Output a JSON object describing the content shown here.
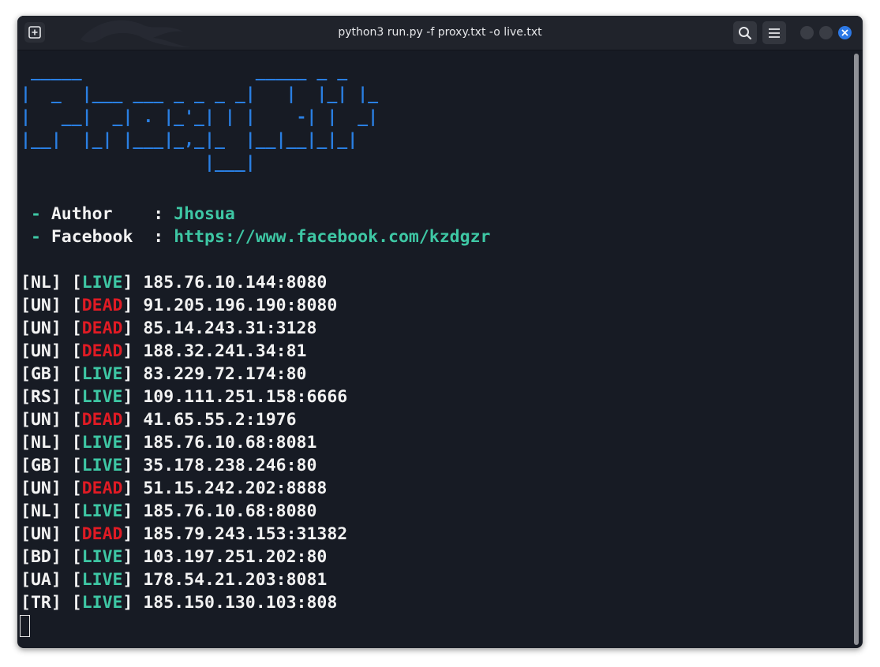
{
  "window": {
    "title": "python3 run.py -f proxy.txt -o live.txt"
  },
  "icons": {
    "new_tab": "plus-square-icon",
    "search": "search-icon",
    "menu": "hamburger-menu-icon",
    "minimize": "minimize-icon",
    "maximize": "maximize-icon",
    "close": "close-icon"
  },
  "colors": {
    "banner": "#2a7fe2",
    "accent": "#3ec7a4",
    "dead": "#e01b24",
    "background": "#171b24"
  },
  "terminal": {
    "banner": [
      " _____                 _____ _ _",
      "|  _  |___ ___ _ _ _ _|   |  |_| |_",
      "|   __|  _| . |_'_| | |    -| |  _|",
      "|__|  |_| |___|_,_|_  |__|__|_|_|",
      "                  |___|"
    ],
    "info": [
      {
        "prefix": " - ",
        "label": "Author    ",
        "sep": ": ",
        "value": "Jhosua"
      },
      {
        "prefix": " - ",
        "label": "Facebook  ",
        "sep": ": ",
        "value": "https://www.facebook.com/kzdgzr"
      }
    ],
    "results": [
      {
        "country": "NL",
        "status": "LIVE",
        "address": "185.76.10.144:8080"
      },
      {
        "country": "UN",
        "status": "DEAD",
        "address": "91.205.196.190:8080"
      },
      {
        "country": "UN",
        "status": "DEAD",
        "address": "85.14.243.31:3128"
      },
      {
        "country": "UN",
        "status": "DEAD",
        "address": "188.32.241.34:81"
      },
      {
        "country": "GB",
        "status": "LIVE",
        "address": "83.229.72.174:80"
      },
      {
        "country": "RS",
        "status": "LIVE",
        "address": "109.111.251.158:6666"
      },
      {
        "country": "UN",
        "status": "DEAD",
        "address": "41.65.55.2:1976"
      },
      {
        "country": "NL",
        "status": "LIVE",
        "address": "185.76.10.68:8081"
      },
      {
        "country": "GB",
        "status": "LIVE",
        "address": "35.178.238.246:80"
      },
      {
        "country": "UN",
        "status": "DEAD",
        "address": "51.15.242.202:8888"
      },
      {
        "country": "NL",
        "status": "LIVE",
        "address": "185.76.10.68:8080"
      },
      {
        "country": "UN",
        "status": "DEAD",
        "address": "185.79.243.153:31382"
      },
      {
        "country": "BD",
        "status": "LIVE",
        "address": "103.197.251.202:80"
      },
      {
        "country": "UA",
        "status": "LIVE",
        "address": "178.54.21.203:8081"
      },
      {
        "country": "TR",
        "status": "LIVE",
        "address": "185.150.130.103:808"
      }
    ]
  }
}
